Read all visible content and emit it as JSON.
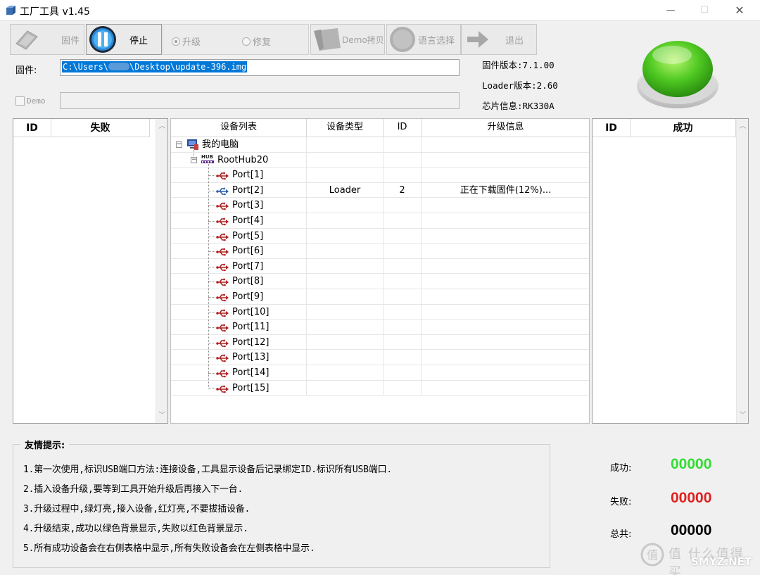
{
  "window": {
    "title": "工厂工具 v1.45"
  },
  "toolbar": {
    "firmware_label": "固件",
    "stop_label": "停止",
    "upgrade_label": "升级",
    "repair_label": "修复",
    "demo_copy_label": "Demo拷贝",
    "language_label": "语言选择",
    "exit_label": "退出"
  },
  "firmware": {
    "label": "固件:",
    "path_user_prefix": "C:\\Users\\",
    "path_suffix": "\\Desktop\\update-396.img"
  },
  "demo": {
    "label": "Demo"
  },
  "info": {
    "fw_version": "固件版本:7.1.00",
    "loader_version": "Loader版本:2.60",
    "chip_info": "芯片信息:RK330A"
  },
  "fail_table": {
    "col_id": "ID",
    "col_status": "失败"
  },
  "success_table": {
    "col_id": "ID",
    "col_status": "成功"
  },
  "device_table": {
    "headers": [
      "设备列表",
      "设备类型",
      "ID",
      "升级信息"
    ],
    "root": "我的电脑",
    "hub": "RootHub20",
    "ports": [
      {
        "name": "Port[1]",
        "type": "",
        "id": "",
        "info": ""
      },
      {
        "name": "Port[2]",
        "type": "Loader",
        "id": "2",
        "info": "正在下载固件(12%)..."
      },
      {
        "name": "Port[3]",
        "type": "",
        "id": "",
        "info": ""
      },
      {
        "name": "Port[4]",
        "type": "",
        "id": "",
        "info": ""
      },
      {
        "name": "Port[5]",
        "type": "",
        "id": "",
        "info": ""
      },
      {
        "name": "Port[6]",
        "type": "",
        "id": "",
        "info": ""
      },
      {
        "name": "Port[7]",
        "type": "",
        "id": "",
        "info": ""
      },
      {
        "name": "Port[8]",
        "type": "",
        "id": "",
        "info": ""
      },
      {
        "name": "Port[9]",
        "type": "",
        "id": "",
        "info": ""
      },
      {
        "name": "Port[10]",
        "type": "",
        "id": "",
        "info": ""
      },
      {
        "name": "Port[11]",
        "type": "",
        "id": "",
        "info": ""
      },
      {
        "name": "Port[12]",
        "type": "",
        "id": "",
        "info": ""
      },
      {
        "name": "Port[13]",
        "type": "",
        "id": "",
        "info": ""
      },
      {
        "name": "Port[14]",
        "type": "",
        "id": "",
        "info": ""
      },
      {
        "name": "Port[15]",
        "type": "",
        "id": "",
        "info": ""
      }
    ]
  },
  "tips": {
    "title": "友情提示:",
    "items": [
      "1.第一次使用,标识USB端口方法:连接设备,工具显示设备后记录绑定ID.标识所有USB端口.",
      "2.插入设备升级,要等到工具开始升级后再接入下一台.",
      "3.升级过程中,绿灯亮,接入设备,红灯亮,不要拔插设备.",
      "4.升级结束,成功以绿色背景显示,失败以红色背景显示.",
      "5.所有成功设备会在右侧表格中显示,所有失败设备会在左侧表格中显示."
    ]
  },
  "stats": {
    "success_label": "成功:",
    "success_value": "00000",
    "success_color": "#33dd33",
    "fail_label": "失败:",
    "fail_value": "00000",
    "fail_color": "#e02020",
    "total_label": "总共:",
    "total_value": "00000",
    "total_color": "#000000"
  },
  "watermark": {
    "text": "值 什么值得买",
    "url": "SMYZ.NET"
  }
}
